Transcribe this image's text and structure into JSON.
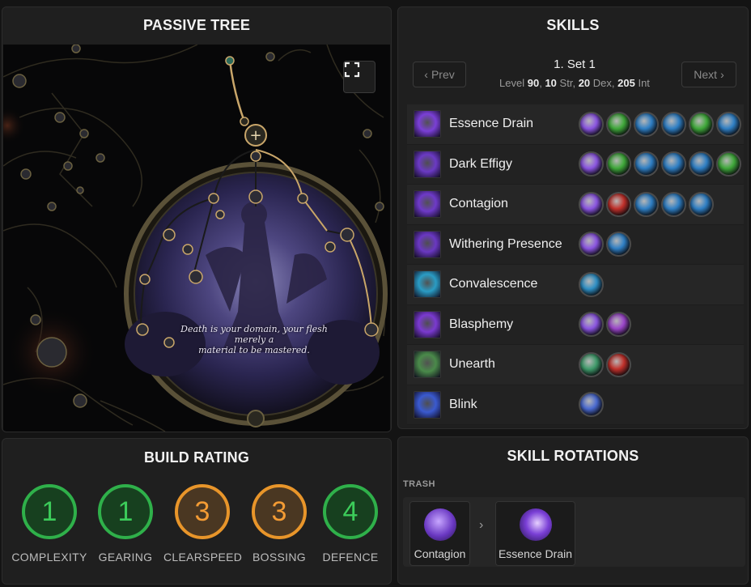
{
  "passive_tree": {
    "title": "PASSIVE TREE",
    "quote_line1": "Death is your domain, your flesh merely a",
    "quote_line2": "material to be mastered.",
    "fullscreen_icon": "fullscreen-icon"
  },
  "skills": {
    "title": "SKILLS",
    "prev_label": "Prev",
    "next_label": "Next",
    "set_title": "1. Set 1",
    "level_label": "Level",
    "level": "90",
    "str": "10",
    "str_label": "Str,",
    "dex": "20",
    "dex_label": "Dex,",
    "int": "205",
    "int_label": "Int",
    "rows": [
      {
        "name": "Essence Drain",
        "icon": "essence-drain-icon",
        "color": "#7a3fd6",
        "gems": [
          "#8a55e0",
          "#3fa83a",
          "#2f7fc4",
          "#2f7fc4",
          "#3fa83a",
          "#2f7fc4"
        ]
      },
      {
        "name": "Dark Effigy",
        "icon": "dark-effigy-icon",
        "color": "#6b3ac4",
        "gems": [
          "#8a55e0",
          "#3fa83a",
          "#2f7fc4",
          "#2f7fc4",
          "#2f7fc4",
          "#3fa83a"
        ]
      },
      {
        "name": "Contagion",
        "icon": "contagion-icon",
        "color": "#6e3ac8",
        "gems": [
          "#8a55e0",
          "#c0302a",
          "#2f7fc4",
          "#2f7fc4",
          "#2f7fc4"
        ]
      },
      {
        "name": "Withering Presence",
        "icon": "withering-presence-icon",
        "color": "#6a38c2",
        "gems": [
          "#8a55e0",
          "#2f7fc4"
        ]
      },
      {
        "name": "Convalescence",
        "icon": "convalescence-icon",
        "color": "#2a9cc4",
        "gems": [
          "#2f8fc4"
        ]
      },
      {
        "name": "Blasphemy",
        "icon": "blasphemy-icon",
        "color": "#7a3ad0",
        "gems": [
          "#8a55e0",
          "#9a45c8"
        ]
      },
      {
        "name": "Unearth",
        "icon": "unearth-icon",
        "color": "#4a8a4a",
        "gems": [
          "#3f9a6a",
          "#c0302a"
        ]
      },
      {
        "name": "Blink",
        "icon": "blink-icon",
        "color": "#3a5ad0",
        "gems": [
          "#4a6ad0"
        ]
      }
    ]
  },
  "build_rating": {
    "title": "BUILD RATING",
    "items": [
      {
        "label": "COMPLEXITY",
        "value": "1",
        "color": "green"
      },
      {
        "label": "GEARING",
        "value": "1",
        "color": "green"
      },
      {
        "label": "CLEARSPEED",
        "value": "3",
        "color": "orange"
      },
      {
        "label": "BOSSING",
        "value": "3",
        "color": "orange"
      },
      {
        "label": "DEFENCE",
        "value": "4",
        "color": "green"
      }
    ]
  },
  "skill_rotations": {
    "title": "SKILL ROTATIONS",
    "group_label": "TRASH",
    "steps": [
      {
        "name": "Contagion",
        "icon": "contagion-icon"
      },
      {
        "name": "Essence Drain",
        "icon": "essence-drain-icon"
      }
    ]
  }
}
